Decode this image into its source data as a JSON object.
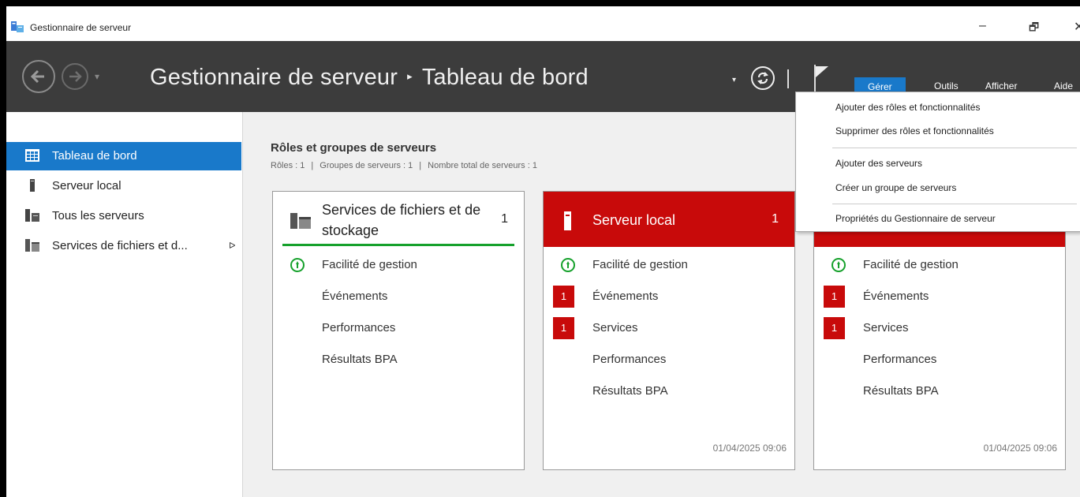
{
  "window": {
    "title": "Gestionnaire de serveur",
    "controls": {
      "minimize": "–",
      "restore": "🗗",
      "close": "✕"
    }
  },
  "header": {
    "breadcrumb_root": "Gestionnaire de serveur",
    "breadcrumb_separator": "▸",
    "breadcrumb_current": "Tableau de bord",
    "menus": [
      "Gérer",
      "Outils",
      "Afficher",
      "Aide"
    ],
    "bg_color": "#3c3c3c",
    "accent_color": "#1979ca"
  },
  "sidebar": {
    "items": [
      {
        "label": "Tableau de bord",
        "icon": "dashboard-grid-icon",
        "active": true
      },
      {
        "label": "Serveur local",
        "icon": "server-icon"
      },
      {
        "label": "Tous les serveurs",
        "icon": "servers-icon"
      },
      {
        "label": "Services de fichiers et d...",
        "icon": "file-services-icon",
        "arrow": "ᐅ"
      }
    ]
  },
  "main": {
    "section_title": "Rôles et groupes de serveurs",
    "stats": [
      "Rôles : 1",
      "Groupes de serveurs : 1",
      "Nombre total de serveurs : 1"
    ],
    "stat_separator": "|",
    "tiles": [
      {
        "title": "Services de fichiers et de stockage",
        "count": "1",
        "rows": [
          "Facilité de gestion",
          "Événements",
          "Performances",
          "Résultats BPA"
        ],
        "timestamp": ""
      },
      {
        "title": "Serveur local",
        "count": "1",
        "rows": [
          "Facilité de gestion",
          "Événements",
          "Services",
          "Performances",
          "Résultats BPA"
        ],
        "badges": {
          "events": "1",
          "services": "1"
        },
        "timestamp": "01/04/2025 09:06"
      },
      {
        "title": "",
        "rows": [
          "Facilité de gestion",
          "Événements",
          "Services",
          "Performances",
          "Résultats BPA"
        ],
        "badges": {
          "events": "1",
          "services": "1"
        },
        "timestamp": "01/04/2025 09:06"
      }
    ],
    "alert_color": "#c80a0a",
    "ok_color": "#16a12c"
  },
  "dropdown": {
    "items": [
      "Ajouter des rôles et fonctionnalités",
      "Supprimer des rôles et fonctionnalités",
      "Ajouter des serveurs",
      "Créer un groupe de serveurs",
      "Propriétés du Gestionnaire de serveur"
    ]
  }
}
